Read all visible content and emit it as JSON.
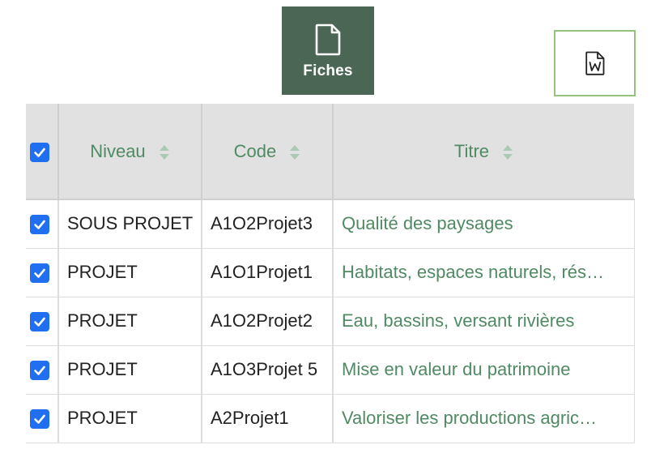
{
  "toolbar": {
    "fiches_label": "Fiches"
  },
  "table": {
    "headers": {
      "select_all_checked": true,
      "niveau": "Niveau",
      "code": "Code",
      "titre": "Titre"
    },
    "rows": [
      {
        "checked": true,
        "niveau": "SOUS PROJET",
        "code": "A1O2Projet3",
        "titre": "Qualité des paysages"
      },
      {
        "checked": true,
        "niveau": "PROJET",
        "code": "A1O1Projet1",
        "titre": "Habitats, espaces naturels, rés…"
      },
      {
        "checked": true,
        "niveau": "PROJET",
        "code": "A1O2Projet2",
        "titre": "Eau, bassins, versant rivières"
      },
      {
        "checked": true,
        "niveau": "PROJET",
        "code": "A1O3Projet 5",
        "titre": "Mise en valeur du patrimoine"
      },
      {
        "checked": true,
        "niveau": "PROJET",
        "code": "A2Projet1",
        "titre": "Valoriser les productions agric…"
      }
    ]
  },
  "colors": {
    "fiches_bg": "#4b6655",
    "accent_green": "#4f8a63",
    "checkbox_blue": "#1f6ff0",
    "word_border": "#94c47a",
    "header_bg": "#e1e1e1"
  },
  "icons": {
    "fiches": "document-icon",
    "word": "word-document-icon",
    "sort": "sort-icon",
    "checkbox": "checkbox-checked-icon"
  }
}
